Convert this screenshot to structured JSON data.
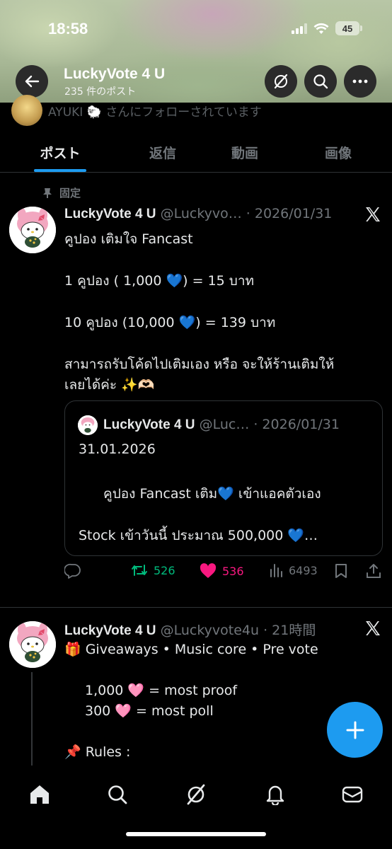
{
  "status": {
    "time": "18:58",
    "battery": "45"
  },
  "header": {
    "name": "LuckyVote 4 U",
    "post_count": "235 件のポスト"
  },
  "follow_note": {
    "text": "AYUKI 🐑 さんにフォローされています"
  },
  "tabs": [
    {
      "label": "ポスト",
      "active": true
    },
    {
      "label": "返信",
      "active": false
    },
    {
      "label": "動画",
      "active": false
    },
    {
      "label": "画像",
      "active": false
    }
  ],
  "pinned_label": "固定",
  "post1": {
    "name": "LuckyVote 4 U",
    "handle_date": "@Luckyvo… · 2026/01/31",
    "lines": [
      "คูปอง เติมใจ Fancast",
      "1 คูปอง ( 1,000 💙) = 15 บาท",
      "10 คูปอง (10,000 💙) = 139 บาท",
      "สามารถรับโค้ดไปเติมเอง หรือ จะให้ร้านเติมให้",
      "เลยได้ค่ะ ✨🫶🏻"
    ],
    "quote": {
      "name": "LuckyVote 4 U",
      "handle_date": "@Luc… · 2026/01/31",
      "lines": [
        "31.01.2026",
        "คูปอง Fancast  เติม💙 เข้าแอคตัวเอง",
        "Stock เข้าวันนี้ ประมาณ 500,000 💙…"
      ]
    },
    "stats": {
      "retweets": "526",
      "likes": "536",
      "views": "6493"
    }
  },
  "post2": {
    "name": "LuckyVote 4 U",
    "handle_date": "@Luckyvote4u · 21時間",
    "lines": [
      "🎁 Giveaways • Music core • Pre vote",
      "1,000 🩷 = most proof",
      "300 🩷 = most poll",
      "📌 Rules :"
    ]
  },
  "colors": {
    "accent": "#1d9bf0",
    "like": "#f91880",
    "retweet": "#00ba7c",
    "background": "#000000"
  }
}
